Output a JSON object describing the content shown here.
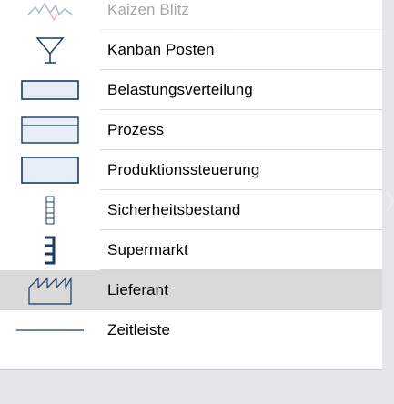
{
  "shapes": {
    "items": [
      {
        "label": "Kaizen Blitz",
        "icon": "kaizen-burst-icon",
        "faded": true
      },
      {
        "label": "Kanban Posten",
        "icon": "kanban-post-icon"
      },
      {
        "label": "Belastungsverteilung",
        "icon": "load-leveling-icon"
      },
      {
        "label": "Prozess",
        "icon": "process-box-icon"
      },
      {
        "label": "Produktionssteuerung",
        "icon": "production-control-icon"
      },
      {
        "label": "Sicherheitsbestand",
        "icon": "safety-stock-icon"
      },
      {
        "label": "Supermarkt",
        "icon": "supermarket-icon"
      },
      {
        "label": "Lieferant",
        "icon": "supplier-factory-icon",
        "selected": true
      },
      {
        "label": "Zeitleiste",
        "icon": "timeline-icon"
      }
    ]
  },
  "colors": {
    "icon_stroke": "#1a3a63",
    "icon_fill": "#e8eef8",
    "selected_bg": "#d9d9d9",
    "accent_red": "#d33a5a"
  }
}
